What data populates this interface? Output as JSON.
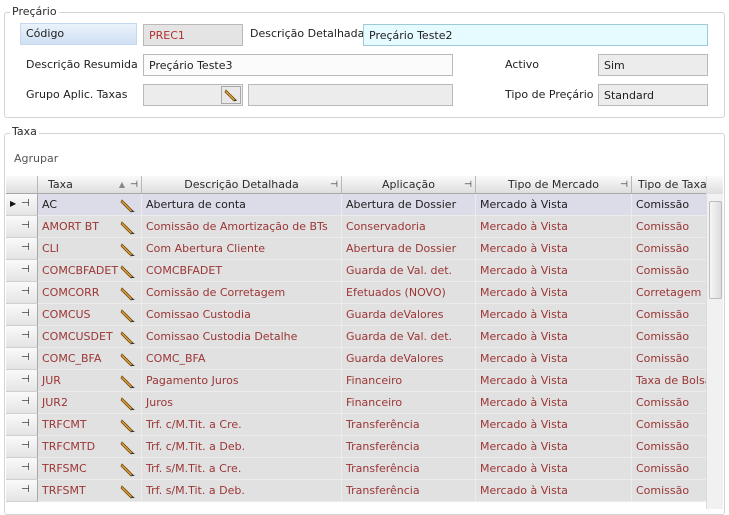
{
  "header": {
    "title": "Preçário",
    "codigo_label": "Código",
    "codigo_value": "PREC1",
    "desc_detalhada_label": "Descrição Detalhada",
    "desc_detalhada_value": "Preçário Teste2",
    "desc_resumida_label": "Descrição Resumida",
    "desc_resumida_value": "Preçário Teste3",
    "activo_label": "Activo",
    "activo_value": "Sim",
    "grupo_label": "Grupo Aplic. Taxas",
    "grupo_value": "",
    "grupo_desc_value": "",
    "tipo_label": "Tipo de Preçário",
    "tipo_value": "Standard"
  },
  "taxa": {
    "title": "Taxa",
    "agrupar_label": "Agrupar",
    "columns": [
      "Taxa",
      "Descrição Detalhada",
      "Aplicação",
      "Tipo de Mercado",
      "Tipo de Taxa"
    ],
    "rows": [
      {
        "taxa": "AC",
        "desc": "Abertura de conta",
        "aplic": "Abertura de Dossier",
        "mercado": "Mercado à Vista",
        "tipo": "Comissão"
      },
      {
        "taxa": "AMORT BT",
        "desc": "Comissão de Amortização de BTs",
        "aplic": "Conservadoria",
        "mercado": "Mercado à Vista",
        "tipo": "Comissão"
      },
      {
        "taxa": "CLI",
        "desc": "Com Abertura Cliente",
        "aplic": "Abertura de Dossier",
        "mercado": "Mercado à Vista",
        "tipo": "Comissão"
      },
      {
        "taxa": "COMCBFADET",
        "desc": "COMCBFADET",
        "aplic": "Guarda de Val. det.",
        "mercado": "Mercado à Vista",
        "tipo": "Comissão"
      },
      {
        "taxa": "COMCORR",
        "desc": "Comissão de Corretagem",
        "aplic": "Efetuados (NOVO)",
        "mercado": "Mercado à Vista",
        "tipo": "Corretagem"
      },
      {
        "taxa": "COMCUS",
        "desc": "Comissao Custodia",
        "aplic": "Guarda deValores",
        "mercado": "Mercado à Vista",
        "tipo": "Comissão"
      },
      {
        "taxa": "COMCUSDET",
        "desc": "Comissao Custodia Detalhe",
        "aplic": "Guarda de Val. det.",
        "mercado": "Mercado à Vista",
        "tipo": "Comissão"
      },
      {
        "taxa": "COMC_BFA",
        "desc": "COMC_BFA",
        "aplic": "Guarda deValores",
        "mercado": "Mercado à Vista",
        "tipo": "Comissão"
      },
      {
        "taxa": "JUR",
        "desc": "Pagamento Juros",
        "aplic": "Financeiro",
        "mercado": "Mercado à Vista",
        "tipo": "Taxa de Bolsa"
      },
      {
        "taxa": "JUR2",
        "desc": "Juros",
        "aplic": "Financeiro",
        "mercado": "Mercado à Vista",
        "tipo": "Comissão"
      },
      {
        "taxa": "TRFCMT",
        "desc": "Trf. c/M.Tit. a Cre.",
        "aplic": "Transferência",
        "mercado": "Mercado à Vista",
        "tipo": "Comissão"
      },
      {
        "taxa": "TRFCMTD",
        "desc": "Trf. c/M.Tit. a Deb.",
        "aplic": "Transferência",
        "mercado": "Mercado à Vista",
        "tipo": "Comissão"
      },
      {
        "taxa": "TRFSMC",
        "desc": "Trf. s/M.Tit. a Cre.",
        "aplic": "Transferência",
        "mercado": "Mercado à Vista",
        "tipo": "Comissão"
      },
      {
        "taxa": "TRFSMT",
        "desc": "Trf. s/M.Tit. a Deb.",
        "aplic": "Transferência",
        "mercado": "Mercado à Vista",
        "tipo": "Comissão"
      }
    ]
  }
}
